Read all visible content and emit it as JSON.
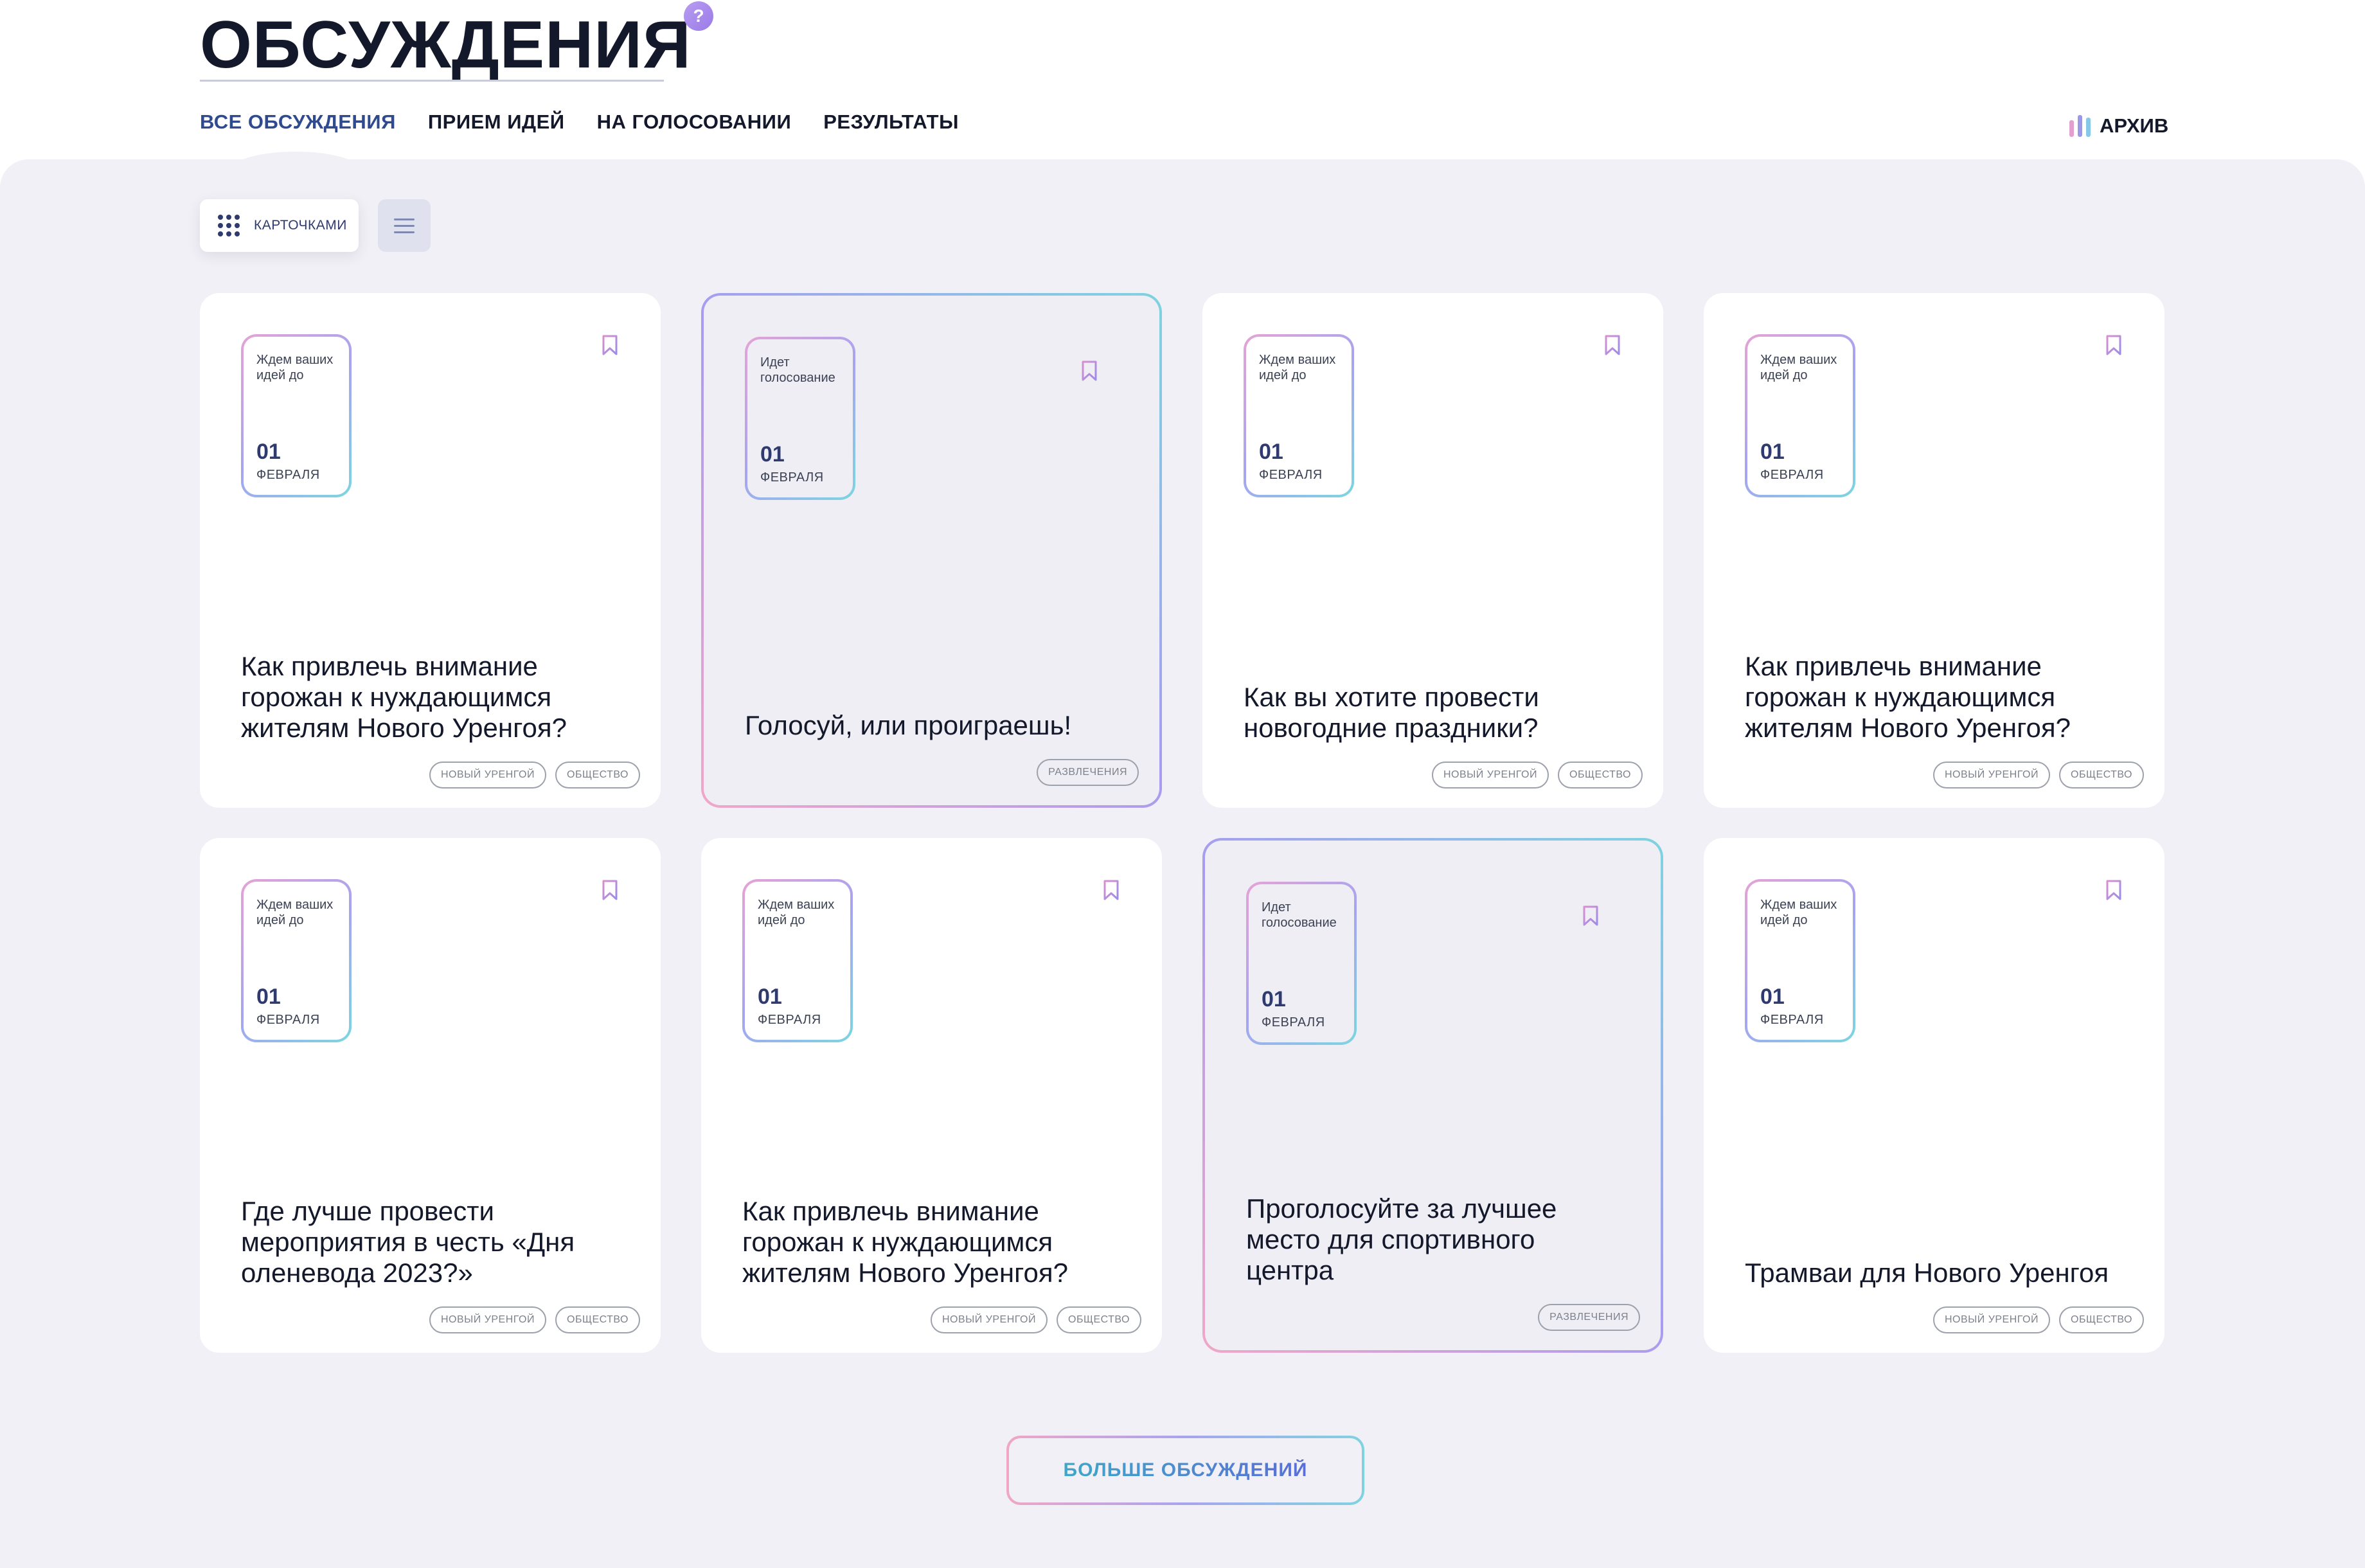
{
  "header": {
    "title": "ОБСУЖДЕНИЯ",
    "help_label": "?",
    "tabs": [
      {
        "label": "ВСЕ ОБСУЖДЕНИЯ",
        "active": true
      },
      {
        "label": "ПРИЕМ ИДЕЙ",
        "active": false
      },
      {
        "label": "НА ГОЛОСОВАНИИ",
        "active": false
      },
      {
        "label": "РЕЗУЛЬТАТЫ",
        "active": false
      }
    ],
    "archive_label": "АРХИВ",
    "archive_icon": "bars-icon"
  },
  "view_toggle": {
    "cards_label": "КАРТОЧКАМИ",
    "cards_icon": "grid-icon",
    "list_icon": "list-icon"
  },
  "cards": [
    {
      "status": "Ждем ваших идей до",
      "day": "01",
      "month": "ФЕВРАЛЯ",
      "title": "Как привлечь внимание горожан к нуждающимся жителям Нового Уренгоя?",
      "tags": [
        "НОВЫЙ УРЕНГОЙ",
        "ОБЩЕСТВО"
      ],
      "voting": false
    },
    {
      "status": "Идет голосование",
      "day": "01",
      "month": "ФЕВРАЛЯ",
      "title": "Голосуй, или проиграешь!",
      "tags": [
        "РАЗВЛЕЧЕНИЯ"
      ],
      "voting": true
    },
    {
      "status": "Ждем ваших идей до",
      "day": "01",
      "month": "ФЕВРАЛЯ",
      "title": "Как вы хотите провести новогодние праздники?",
      "tags": [
        "НОВЫЙ УРЕНГОЙ",
        "ОБЩЕСТВО"
      ],
      "voting": false
    },
    {
      "status": "Ждем ваших идей до",
      "day": "01",
      "month": "ФЕВРАЛЯ",
      "title": "Как привлечь внимание горожан к нуждающимся жителям Нового Уренгоя?",
      "tags": [
        "НОВЫЙ УРЕНГОЙ",
        "ОБЩЕСТВО"
      ],
      "voting": false
    },
    {
      "status": "Ждем ваших идей до",
      "day": "01",
      "month": "ФЕВРАЛЯ",
      "title": "Где лучше провести мероприятия в честь «Дня оленевода 2023?»",
      "tags": [
        "НОВЫЙ УРЕНГОЙ",
        "ОБЩЕСТВО"
      ],
      "voting": false
    },
    {
      "status": "Ждем ваших идей до",
      "day": "01",
      "month": "ФЕВРАЛЯ",
      "title": "Как привлечь внимание горожан к нуждающимся жителям Нового Уренгоя?",
      "tags": [
        "НОВЫЙ УРЕНГОЙ",
        "ОБЩЕСТВО"
      ],
      "voting": false
    },
    {
      "status": "Идет голосование",
      "day": "01",
      "month": "ФЕВРАЛЯ",
      "title": "Проголосуйте за лучшее место для спортивного центра",
      "tags": [
        "РАЗВЛЕЧЕНИЯ"
      ],
      "voting": true
    },
    {
      "status": "Ждем ваших идей до",
      "day": "01",
      "month": "ФЕВРАЛЯ",
      "title": "Трамваи для Нового Уренгоя",
      "tags": [
        "НОВЫЙ УРЕНГОЙ",
        "ОБЩЕСТВО"
      ],
      "voting": false
    }
  ],
  "more_button": {
    "label": "БОЛЬШЕ ОБСУЖДЕНИЙ"
  },
  "colors": {
    "accent": "#2f4a8f",
    "title": "#14182b",
    "background": "#f1f0f6",
    "gradient_pink": "#f1a7c8",
    "gradient_purple": "#a89cf0",
    "gradient_cyan": "#7fd3e0"
  }
}
